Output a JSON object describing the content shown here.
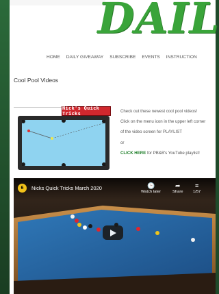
{
  "header": {
    "logo_text": "DAIL"
  },
  "nav": {
    "items": [
      "HOME",
      "DAILY GIVEAWAY",
      "SUBSCRIBE",
      "EVENTS",
      "INSTRUCTION"
    ]
  },
  "section": {
    "title": "Cool Pool Videos"
  },
  "thumbnail": {
    "title": "Nick's Quick Tricks"
  },
  "description": {
    "line1": "Check out these newest cool pool videos!",
    "line2": "Click on the menu icon in the upper left corner",
    "line3": "of the video screen for PLAYLIST",
    "line4": "or",
    "link": "CLICK HERE",
    "line5": " for PB&B's YouTube playlist!"
  },
  "video": {
    "channel_letter": "6",
    "title": "Nicks Quick Tricks March 2020",
    "watch_later": "Watch later",
    "share": "Share",
    "count": "1/57"
  },
  "colors": {
    "brand_green": "#3aa43a",
    "felt_blue": "#8fd3f0",
    "link_green": "#1f7f2a",
    "thumb_red": "#d0282e"
  }
}
